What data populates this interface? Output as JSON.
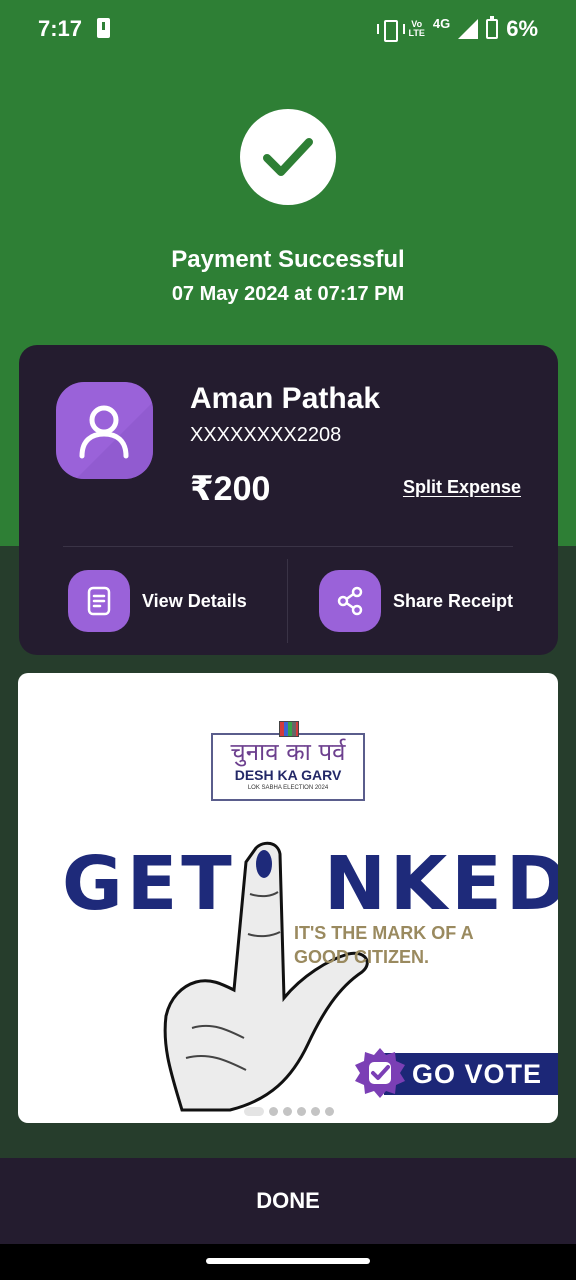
{
  "status_bar": {
    "time": "7:17",
    "volte_top": "Vo",
    "volte_bottom": "LTE",
    "network": "4G",
    "battery": "6%"
  },
  "header": {
    "title": "Payment Successful",
    "datetime": "07 May 2024 at 07:17 PM",
    "icon": "check-icon"
  },
  "receipt": {
    "payee_name": "Aman Pathak",
    "account_masked": "XXXXXXXX2208",
    "amount": "₹200",
    "split_label": "Split Expense",
    "actions": [
      {
        "label": "View Details",
        "icon": "document-icon"
      },
      {
        "label": "Share Receipt",
        "icon": "share-icon"
      }
    ]
  },
  "banner": {
    "logo_hindi": "चुनाव का पर्व",
    "logo_english": "DESH KA GARV",
    "logo_sub": "LOK SABHA ELECTION 2024",
    "headline_left": "GET",
    "headline_right": "NKED",
    "tagline_line1": "IT'S THE MARK OF A",
    "tagline_line2": "GOOD CITIZEN.",
    "cta": "GO VOTE",
    "slide_count": 6,
    "active_slide": 1
  },
  "footer": {
    "done_label": "DONE"
  },
  "colors": {
    "success_green": "#2e7f35",
    "dark_background": "#263d2c",
    "card_background": "#241c2f",
    "accent_purple": "#9a62d9",
    "banner_navy": "#1e2a7a"
  }
}
